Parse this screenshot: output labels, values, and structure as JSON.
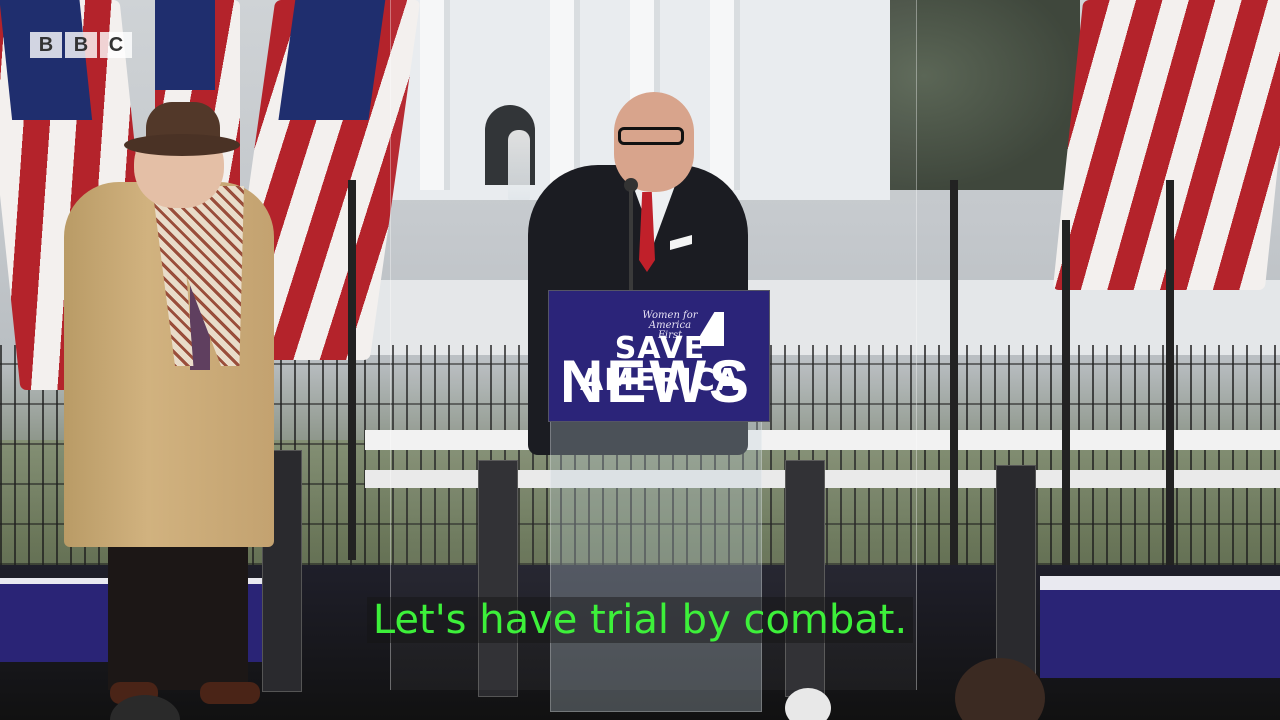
{
  "broadcaster": {
    "logo_letters": [
      "B",
      "B",
      "C"
    ],
    "watermark": "NEWS"
  },
  "podium": {
    "logo_text": "Women for America First",
    "sign_text": "SAVE AMERICA"
  },
  "subtitle": {
    "text": "Let's have trial by combat.",
    "color": "#3df03a"
  },
  "colors": {
    "podium_blue": "#2b2479",
    "flag_red": "#b4232b",
    "tie_red": "#c0202a"
  }
}
